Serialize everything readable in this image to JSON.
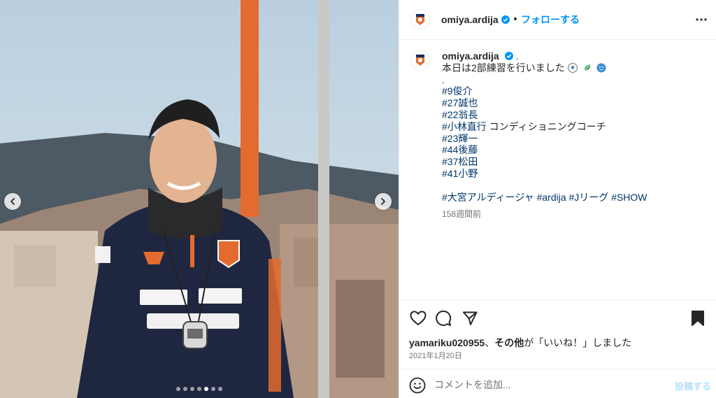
{
  "post": {
    "username": "omiya.ardija",
    "follow_label": "フォローする",
    "separator": "•",
    "more_icon": "more-horizontal-icon",
    "accent": "#0095f6"
  },
  "caption": {
    "username": "omiya.ardija",
    "after_name": ".",
    "first_line": "本日は2部練習を行いました",
    "emojis": [
      "soccer-ball-emoji",
      "leaf-emoji",
      "face-emoji"
    ],
    "dot_line": ".",
    "lines": [
      {
        "tag": "#9俊介",
        "rest": ""
      },
      {
        "tag": "#27誠也",
        "rest": ""
      },
      {
        "tag": "#22翁長",
        "rest": ""
      },
      {
        "tag": "#小林直行",
        "rest": " コンディショニングコーチ"
      },
      {
        "tag": "#23輝一",
        "rest": ""
      },
      {
        "tag": "#44後藤",
        "rest": ""
      },
      {
        "tag": "#37松田",
        "rest": ""
      },
      {
        "tag": "#41小野",
        "rest": ""
      }
    ],
    "hashtags": [
      "#大宮アルディージャ",
      "#ardija",
      "#Jリーグ",
      "#SHOW"
    ],
    "time_ago": "158週間前"
  },
  "actions": {
    "icons": [
      "heart-icon",
      "comment-icon",
      "share-icon",
      "bookmark-icon"
    ]
  },
  "likes": {
    "user": "yamariku020955",
    "connector": "、",
    "others": "その他",
    "suffix": "が「いいね！」しました"
  },
  "date": "2021年1月20日",
  "comment": {
    "placeholder": "コメントを追加...",
    "post_label": "投稿する"
  },
  "carousel": {
    "slide_count": 7,
    "active_index": 4
  }
}
